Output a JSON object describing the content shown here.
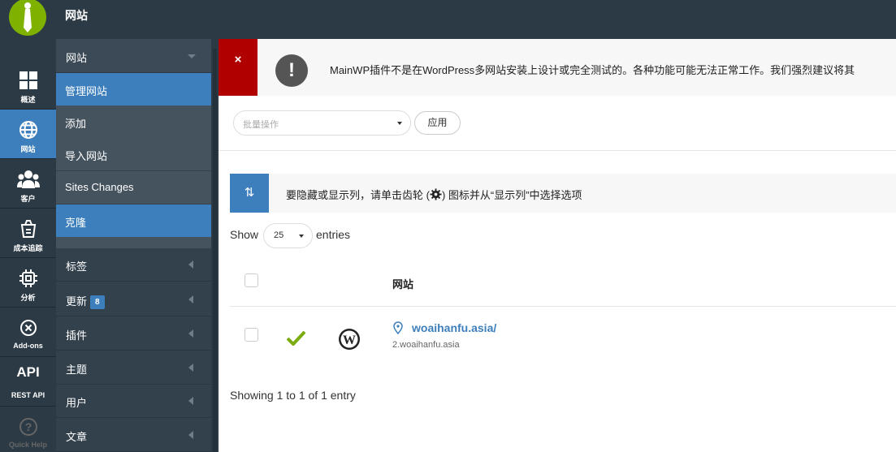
{
  "header": {
    "title": "网站"
  },
  "rail": {
    "items": [
      {
        "label": "概述",
        "icon": "dashboard-icon",
        "active": false
      },
      {
        "label": "网站",
        "icon": "globe-icon",
        "active": true
      },
      {
        "label": "客户",
        "icon": "clients-icon",
        "active": false
      },
      {
        "label": "成本追踪",
        "icon": "cost-tracker-icon",
        "active": false
      },
      {
        "label": "分析",
        "icon": "chip-icon",
        "active": false
      },
      {
        "label": "Add-ons",
        "icon": "addons-icon",
        "active": false
      },
      {
        "label": "REST API",
        "big": "API",
        "active": false
      },
      {
        "label": "Quick Help",
        "icon": "help-icon",
        "active": false
      }
    ]
  },
  "submenu": {
    "heading": "网站",
    "items": [
      {
        "label": "管理网站",
        "active": true
      },
      {
        "label": "添加",
        "active": false
      },
      {
        "label": "导入网站",
        "active": false
      },
      {
        "label": "Sites Changes",
        "active": false
      },
      {
        "label": "克隆",
        "active": true
      }
    ],
    "sections": [
      {
        "label": "标签"
      },
      {
        "label": "更新",
        "badge": "8"
      },
      {
        "label": "插件"
      },
      {
        "label": "主题"
      },
      {
        "label": "用户"
      },
      {
        "label": "文章"
      }
    ]
  },
  "notice": {
    "close": "×",
    "icon": "!",
    "text": "MainWP插件不是在WordPress多网站安装上设计或完全测试的。各种功能可能无法正常工作。我们强烈建议将其"
  },
  "bulk": {
    "placeholder": "批量操作",
    "apply_label": "应用"
  },
  "info": {
    "icon": "⇅",
    "text_before": "要隐藏或显示列，请单击齿轮 (",
    "text_after": ") 图标并从“显示列”中选择选项"
  },
  "table": {
    "show_label": "Show",
    "length_value": "25",
    "entries_label": "entries",
    "header_site": "网站",
    "rows": [
      {
        "site_name": "woaihanfu.asia/",
        "site_sub": "2.woaihanfu.asia",
        "status": "ok"
      }
    ],
    "showing_text": "Showing 1 to 1 of 1 entry"
  },
  "colors": {
    "brand_green": "#7fb100",
    "accent_blue": "#3d7fbd",
    "sidebar_dark": "#2b3a45",
    "error_red": "#b00000",
    "ok_green": "#7aab0f"
  }
}
